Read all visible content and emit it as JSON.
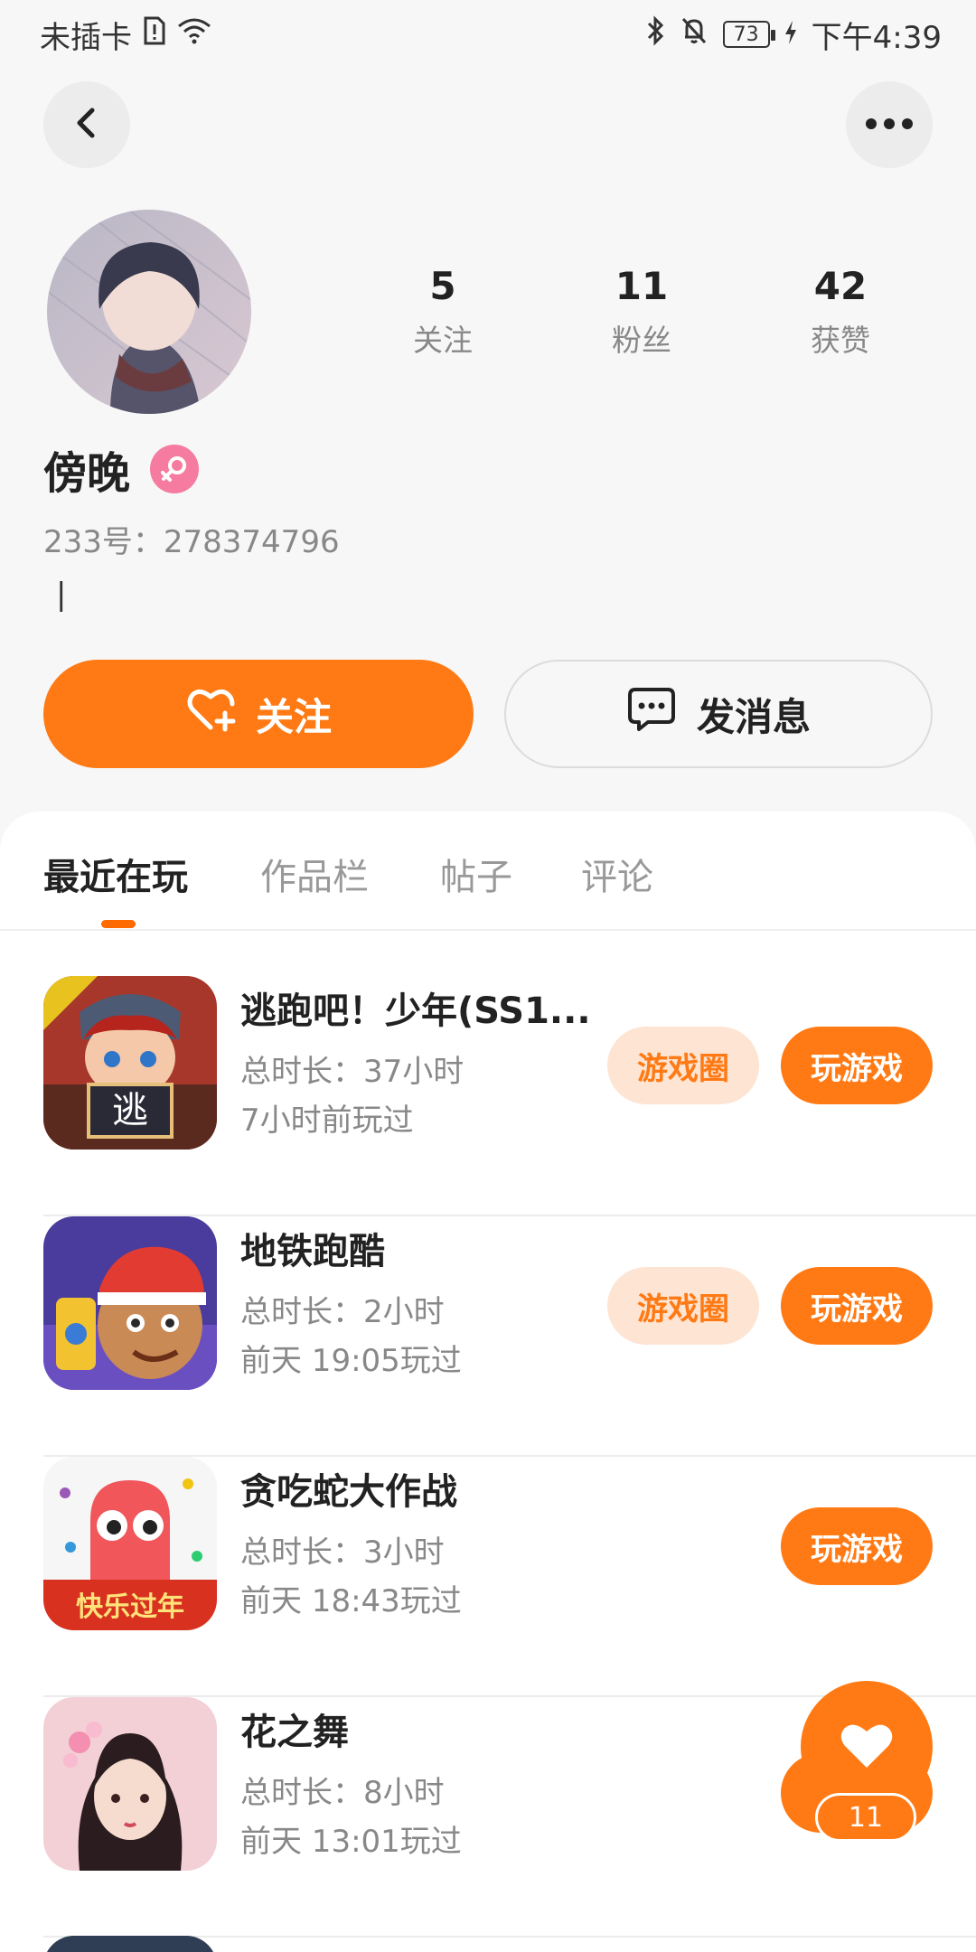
{
  "status_bar": {
    "carrier": "未插卡",
    "battery": "73",
    "time": "下午4:39"
  },
  "profile": {
    "nickname": "傍晚",
    "id_text": "233号：278374796",
    "bio": "|",
    "stats": [
      {
        "value": "5",
        "label": "关注"
      },
      {
        "value": "11",
        "label": "粉丝"
      },
      {
        "value": "42",
        "label": "获赞"
      }
    ]
  },
  "actions": {
    "follow": "关注",
    "message": "发消息"
  },
  "tabs": [
    {
      "label": "最近在玩",
      "active": true
    },
    {
      "label": "作品栏",
      "active": false
    },
    {
      "label": "帖子",
      "active": false
    },
    {
      "label": "评论",
      "active": false
    }
  ],
  "games": [
    {
      "title": "逃跑吧！少年(SS1...",
      "duration": "总时长：37小时",
      "last_played": "7小时前玩过",
      "circle_label": "游戏圈",
      "play_label": "玩游戏"
    },
    {
      "title": "地铁跑酷",
      "duration": "总时长：2小时",
      "last_played": "前天 19:05玩过",
      "circle_label": "游戏圈",
      "play_label": "玩游戏"
    },
    {
      "title": "贪吃蛇大作战",
      "duration": "总时长：3小时",
      "last_played": "前天 18:43玩过",
      "play_label": "玩游戏"
    },
    {
      "title": "花之舞",
      "duration": "总时长：8小时",
      "last_played": "前天 13:01玩过"
    }
  ],
  "float_like": {
    "count": "11"
  },
  "colors": {
    "accent": "#ff7a14",
    "accent_light": "#fde4d3"
  }
}
